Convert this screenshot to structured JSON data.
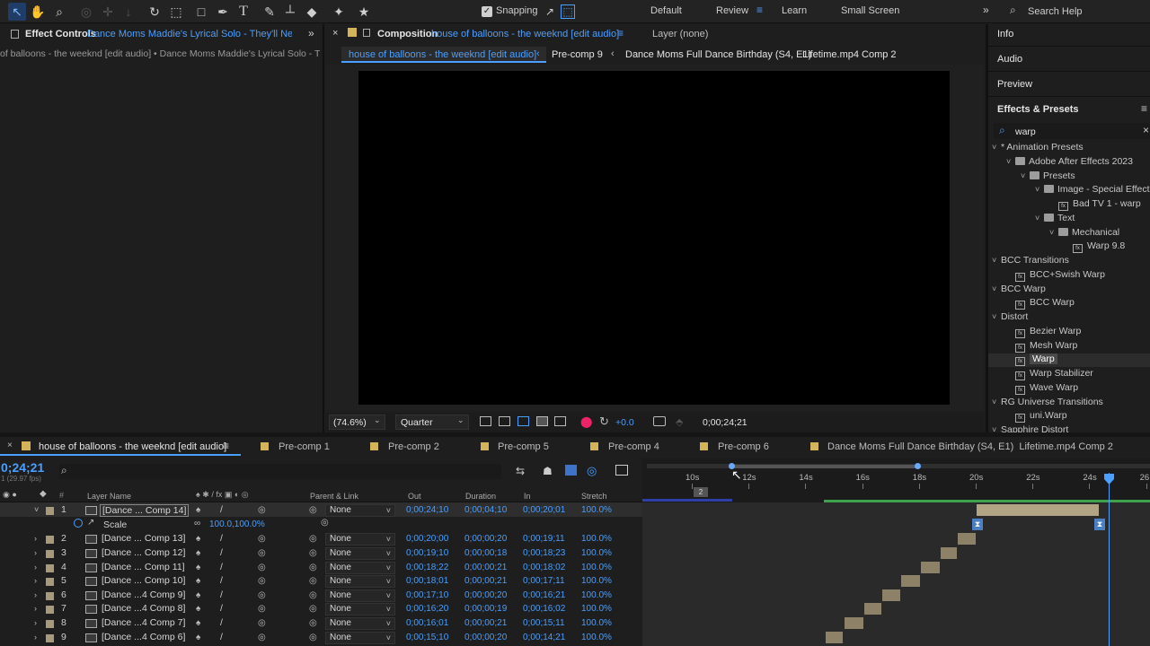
{
  "toolbar": {
    "snapping_label": "Snapping",
    "workspaces": [
      "Default",
      "Review",
      "Learn",
      "Small Screen"
    ],
    "active_workspace": "Review",
    "search_help": "Search Help",
    "accent": "#4a9fff"
  },
  "effect_controls": {
    "tab_label": "Effect Controls",
    "tab_target": "Dance Moms Maddie's Lyrical Solo - They'll Neve",
    "breadcrumb": "of balloons - the weeknd [edit audio] • Dance Moms Maddie's Lyrical Solo - Tl"
  },
  "composition": {
    "tab_label": "Composition",
    "tab_target": "house of balloons - the weeknd [edit audio]",
    "layer_tab": "Layer (none)",
    "flow": [
      "house of balloons - the weeknd [edit audio]",
      "Pre-comp 9",
      "Dance Moms Full Dance Birthday (S4, E1)",
      "Lifetime.mp4 Comp 2"
    ],
    "zoom": "(74.6%)",
    "resolution": "Quarter",
    "exposure": "+0.0",
    "current_time": "0;00;24;21"
  },
  "right_panels": {
    "items": [
      "Info",
      "Audio",
      "Preview"
    ],
    "effects_title": "Effects & Presets",
    "search_value": "warp",
    "tree": [
      {
        "label": "* Animation Presets",
        "level": 0,
        "kind": "group"
      },
      {
        "label": "Adobe After Effects 2023",
        "level": 1,
        "kind": "folder"
      },
      {
        "label": "Presets",
        "level": 2,
        "kind": "folder"
      },
      {
        "label": "Image - Special Effects",
        "level": 3,
        "kind": "folder"
      },
      {
        "label": "Bad TV 1 - warp",
        "level": 4,
        "kind": "preset"
      },
      {
        "label": "Text",
        "level": 3,
        "kind": "folder"
      },
      {
        "label": "Mechanical",
        "level": 4,
        "kind": "folder"
      },
      {
        "label": "Warp 9.8",
        "level": 5,
        "kind": "preset"
      },
      {
        "label": "BCC Transitions",
        "level": 0,
        "kind": "group"
      },
      {
        "label": "BCC+Swish Warp",
        "level": 1,
        "kind": "effect"
      },
      {
        "label": "BCC Warp",
        "level": 0,
        "kind": "group"
      },
      {
        "label": "BCC Warp",
        "level": 1,
        "kind": "effect"
      },
      {
        "label": "Distort",
        "level": 0,
        "kind": "group"
      },
      {
        "label": "Bezier Warp",
        "level": 1,
        "kind": "effect"
      },
      {
        "label": "Mesh Warp",
        "level": 1,
        "kind": "effect"
      },
      {
        "label": "Warp",
        "level": 1,
        "kind": "effect",
        "selected": true
      },
      {
        "label": "Warp Stabilizer",
        "level": 1,
        "kind": "effect"
      },
      {
        "label": "Wave Warp",
        "level": 1,
        "kind": "effect"
      },
      {
        "label": "RG Universe Transitions",
        "level": 0,
        "kind": "group"
      },
      {
        "label": "uni.Warp",
        "level": 1,
        "kind": "effect"
      },
      {
        "label": "Sapphire Distort",
        "level": 0,
        "kind": "group"
      }
    ]
  },
  "timeline": {
    "active_tab": "house of balloons - the weeknd [edit audio]",
    "tabs": [
      "Pre-comp 1",
      "Pre-comp 2",
      "Pre-comp 5",
      "Pre-comp 4",
      "Pre-comp 6",
      "Dance Moms Full Dance Birthday (S4, E1)  Lifetime.mp4 Comp 2"
    ],
    "timecode": "0;24;21",
    "fps": "1 (29.97 fps)",
    "columns": {
      "layer_name": "Layer Name",
      "parent": "Parent & Link",
      "out": "Out",
      "duration": "Duration",
      "in": "In",
      "stretch": "Stretch"
    },
    "ruler_ticks": [
      "10s",
      "12s",
      "14s",
      "16s",
      "18s",
      "20s",
      "22s",
      "24s",
      "26"
    ],
    "scale_label": "Scale",
    "scale_value": "100.0,100.0%",
    "layers": [
      {
        "num": "1",
        "name": "[Dance ... Comp 14]",
        "parent": "None",
        "out": "0;00;24;10",
        "duration": "0;00;04;10",
        "in": "0;00;20;01",
        "stretch": "100.0%",
        "start": 20.03,
        "end": 24.33
      },
      {
        "num": "2",
        "name": "[Dance ... Comp 13]",
        "parent": "None",
        "out": "0;00;20;00",
        "duration": "0;00;00;20",
        "in": "0;00;19;11",
        "stretch": "100.0%",
        "start": 19.37,
        "end": 20.0
      },
      {
        "num": "3",
        "name": "[Dance ... Comp 12]",
        "parent": "None",
        "out": "0;00;19;10",
        "duration": "0;00;00;18",
        "in": "0;00;18;23",
        "stretch": "100.0%",
        "start": 18.77,
        "end": 19.33
      },
      {
        "num": "4",
        "name": "[Dance ... Comp 11]",
        "parent": "None",
        "out": "0;00;18;22",
        "duration": "0;00;00;21",
        "in": "0;00;18;02",
        "stretch": "100.0%",
        "start": 18.07,
        "end": 18.73
      },
      {
        "num": "5",
        "name": "[Dance ... Comp 10]",
        "parent": "None",
        "out": "0;00;18;01",
        "duration": "0;00;00;21",
        "in": "0;00;17;11",
        "stretch": "100.0%",
        "start": 17.37,
        "end": 18.03
      },
      {
        "num": "6",
        "name": "[Dance ...4 Comp 9]",
        "parent": "None",
        "out": "0;00;17;10",
        "duration": "0;00;00;20",
        "in": "0;00;16;21",
        "stretch": "100.0%",
        "start": 16.7,
        "end": 17.33
      },
      {
        "num": "7",
        "name": "[Dance ...4 Comp 8]",
        "parent": "None",
        "out": "0;00;16;20",
        "duration": "0;00;00;19",
        "in": "0;00;16;02",
        "stretch": "100.0%",
        "start": 16.07,
        "end": 16.67
      },
      {
        "num": "8",
        "name": "[Dance ...4 Comp 7]",
        "parent": "None",
        "out": "0;00;16;01",
        "duration": "0;00;00;21",
        "in": "0;00;15;11",
        "stretch": "100.0%",
        "start": 15.37,
        "end": 16.03
      },
      {
        "num": "9",
        "name": "[Dance ...4 Comp 6]",
        "parent": "None",
        "out": "0;00;15;10",
        "duration": "0;00;00;20",
        "in": "0;00;14;21",
        "stretch": "100.0%",
        "start": 14.7,
        "end": 15.33
      }
    ]
  }
}
